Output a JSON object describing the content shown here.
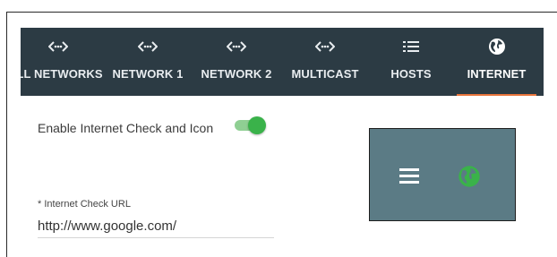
{
  "tabs": [
    {
      "label": "ALL NETWORKS",
      "icon": "network-icon"
    },
    {
      "label": "NETWORK 1",
      "icon": "network-icon"
    },
    {
      "label": "NETWORK 2",
      "icon": "network-icon"
    },
    {
      "label": "MULTICAST",
      "icon": "network-icon"
    },
    {
      "label": "HOSTS",
      "icon": "list-icon"
    },
    {
      "label": "INTERNET",
      "icon": "globe-icon",
      "active": true
    }
  ],
  "settings": {
    "enable_label": "Enable Internet Check and Icon",
    "enable_checked": true,
    "url_label": "* Internet Check URL",
    "url_value": "http://www.google.com/"
  },
  "preview": {
    "icons": [
      "menu-icon",
      "globe-icon"
    ]
  },
  "colors": {
    "topbar": "#2c3b44",
    "active_underline": "#e8743b",
    "toggle_on": "#3ab24a",
    "preview_bg": "#5b7b85",
    "globe_green": "#3ab24a"
  }
}
